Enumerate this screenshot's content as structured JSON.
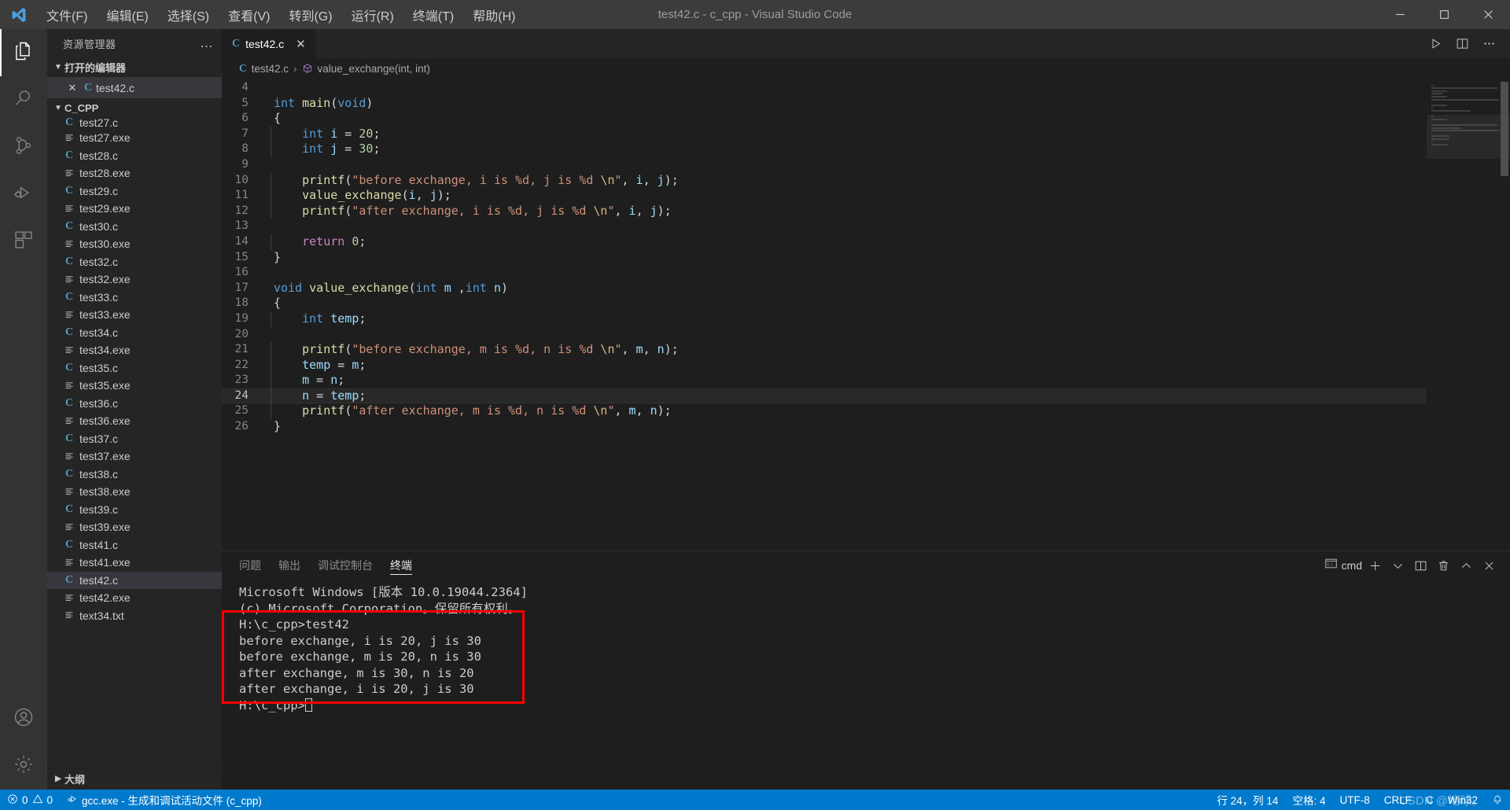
{
  "window": {
    "title": "test42.c - c_cpp - Visual Studio Code",
    "minimize": "─",
    "maximize": "□",
    "close": "✕"
  },
  "menu": [
    {
      "label": "文件(F)"
    },
    {
      "label": "编辑(E)"
    },
    {
      "label": "选择(S)"
    },
    {
      "label": "查看(V)"
    },
    {
      "label": "转到(G)"
    },
    {
      "label": "运行(R)"
    },
    {
      "label": "终端(T)"
    },
    {
      "label": "帮助(H)"
    }
  ],
  "activity_bar": [
    {
      "name": "explorer",
      "icon": "files-icon",
      "active": true
    },
    {
      "name": "search",
      "icon": "search-icon",
      "active": false
    },
    {
      "name": "source-control",
      "icon": "source-control-icon",
      "active": false
    },
    {
      "name": "run-debug",
      "icon": "run-debug-icon",
      "active": false
    },
    {
      "name": "extensions",
      "icon": "extensions-icon",
      "active": false
    },
    {
      "name": "accounts",
      "icon": "account-icon",
      "active": false
    },
    {
      "name": "settings",
      "icon": "gear-icon",
      "active": false
    }
  ],
  "sidebar": {
    "title": "资源管理器",
    "more_actions": "…",
    "open_editors": {
      "label": "打开的编辑器",
      "items": [
        {
          "name": "test42.c",
          "icon": "c-file-icon",
          "selected": true,
          "close": "✕"
        }
      ]
    },
    "folder": {
      "label": "C_CPP",
      "items": [
        {
          "name": "test27.c",
          "icon": "c-file-icon",
          "selected": false,
          "partial": true
        },
        {
          "name": "test27.exe",
          "icon": "exe-file-icon",
          "selected": false
        },
        {
          "name": "test28.c",
          "icon": "c-file-icon",
          "selected": false
        },
        {
          "name": "test28.exe",
          "icon": "exe-file-icon",
          "selected": false
        },
        {
          "name": "test29.c",
          "icon": "c-file-icon",
          "selected": false
        },
        {
          "name": "test29.exe",
          "icon": "exe-file-icon",
          "selected": false
        },
        {
          "name": "test30.c",
          "icon": "c-file-icon",
          "selected": false
        },
        {
          "name": "test30.exe",
          "icon": "exe-file-icon",
          "selected": false
        },
        {
          "name": "test32.c",
          "icon": "c-file-icon",
          "selected": false
        },
        {
          "name": "test32.exe",
          "icon": "exe-file-icon",
          "selected": false
        },
        {
          "name": "test33.c",
          "icon": "c-file-icon",
          "selected": false
        },
        {
          "name": "test33.exe",
          "icon": "exe-file-icon",
          "selected": false
        },
        {
          "name": "test34.c",
          "icon": "c-file-icon",
          "selected": false
        },
        {
          "name": "test34.exe",
          "icon": "exe-file-icon",
          "selected": false
        },
        {
          "name": "test35.c",
          "icon": "c-file-icon",
          "selected": false
        },
        {
          "name": "test35.exe",
          "icon": "exe-file-icon",
          "selected": false
        },
        {
          "name": "test36.c",
          "icon": "c-file-icon",
          "selected": false
        },
        {
          "name": "test36.exe",
          "icon": "exe-file-icon",
          "selected": false
        },
        {
          "name": "test37.c",
          "icon": "c-file-icon",
          "selected": false
        },
        {
          "name": "test37.exe",
          "icon": "exe-file-icon",
          "selected": false
        },
        {
          "name": "test38.c",
          "icon": "c-file-icon",
          "selected": false
        },
        {
          "name": "test38.exe",
          "icon": "exe-file-icon",
          "selected": false
        },
        {
          "name": "test39.c",
          "icon": "c-file-icon",
          "selected": false
        },
        {
          "name": "test39.exe",
          "icon": "exe-file-icon",
          "selected": false
        },
        {
          "name": "test41.c",
          "icon": "c-file-icon",
          "selected": false
        },
        {
          "name": "test41.exe",
          "icon": "exe-file-icon",
          "selected": false
        },
        {
          "name": "test42.c",
          "icon": "c-file-icon",
          "selected": true
        },
        {
          "name": "test42.exe",
          "icon": "exe-file-icon",
          "selected": false
        },
        {
          "name": "text34.txt",
          "icon": "exe-file-icon",
          "selected": false
        }
      ]
    },
    "outline": {
      "label": "大纲"
    }
  },
  "editor": {
    "tab": {
      "name": "test42.c",
      "icon": "c-file-icon",
      "close": "✕"
    },
    "tab_actions": [
      {
        "name": "run-code-button",
        "icon": "play-icon"
      },
      {
        "name": "split-editor-button",
        "icon": "split-icon"
      },
      {
        "name": "more-actions-button",
        "icon": "ellipsis-icon"
      }
    ],
    "breadcrumb": {
      "file": "test42.c",
      "separator": "›",
      "symbol": "value_exchange(int, int)"
    },
    "first_visible_line": 4,
    "current_line": 24,
    "lines": [
      {
        "n": 4,
        "tokens": []
      },
      {
        "n": 5,
        "tokens": [
          {
            "t": "int",
            "c": "kw"
          },
          {
            "t": " ",
            "c": "pun"
          },
          {
            "t": "main",
            "c": "fn"
          },
          {
            "t": "(",
            "c": "pun"
          },
          {
            "t": "void",
            "c": "kw"
          },
          {
            "t": ")",
            "c": "pun"
          }
        ]
      },
      {
        "n": 6,
        "tokens": [
          {
            "t": "{",
            "c": "pun"
          }
        ]
      },
      {
        "n": 7,
        "indent": 1,
        "tokens": [
          {
            "t": "    ",
            "c": "pun"
          },
          {
            "t": "int",
            "c": "kw"
          },
          {
            "t": " ",
            "c": "pun"
          },
          {
            "t": "i",
            "c": "var"
          },
          {
            "t": " = ",
            "c": "pun"
          },
          {
            "t": "20",
            "c": "num"
          },
          {
            "t": ";",
            "c": "pun"
          }
        ]
      },
      {
        "n": 8,
        "indent": 1,
        "tokens": [
          {
            "t": "    ",
            "c": "pun"
          },
          {
            "t": "int",
            "c": "kw"
          },
          {
            "t": " ",
            "c": "pun"
          },
          {
            "t": "j",
            "c": "var"
          },
          {
            "t": " = ",
            "c": "pun"
          },
          {
            "t": "30",
            "c": "num"
          },
          {
            "t": ";",
            "c": "pun"
          }
        ]
      },
      {
        "n": 9,
        "indent": 1,
        "tokens": []
      },
      {
        "n": 10,
        "indent": 1,
        "tokens": [
          {
            "t": "    ",
            "c": "pun"
          },
          {
            "t": "printf",
            "c": "fn"
          },
          {
            "t": "(",
            "c": "pun"
          },
          {
            "t": "\"before exchange, i is %d, j is %d ",
            "c": "str"
          },
          {
            "t": "\\n",
            "c": "esc"
          },
          {
            "t": "\"",
            "c": "str"
          },
          {
            "t": ", ",
            "c": "pun"
          },
          {
            "t": "i",
            "c": "var"
          },
          {
            "t": ", ",
            "c": "pun"
          },
          {
            "t": "j",
            "c": "var"
          },
          {
            "t": ");",
            "c": "pun"
          }
        ]
      },
      {
        "n": 11,
        "indent": 1,
        "tokens": [
          {
            "t": "    ",
            "c": "pun"
          },
          {
            "t": "value_exchange",
            "c": "fn"
          },
          {
            "t": "(",
            "c": "pun"
          },
          {
            "t": "i",
            "c": "var"
          },
          {
            "t": ", ",
            "c": "pun"
          },
          {
            "t": "j",
            "c": "var"
          },
          {
            "t": ");",
            "c": "pun"
          }
        ]
      },
      {
        "n": 12,
        "indent": 1,
        "tokens": [
          {
            "t": "    ",
            "c": "pun"
          },
          {
            "t": "printf",
            "c": "fn"
          },
          {
            "t": "(",
            "c": "pun"
          },
          {
            "t": "\"after exchange, i is %d, j is %d ",
            "c": "str"
          },
          {
            "t": "\\n",
            "c": "esc"
          },
          {
            "t": "\"",
            "c": "str"
          },
          {
            "t": ", ",
            "c": "pun"
          },
          {
            "t": "i",
            "c": "var"
          },
          {
            "t": ", ",
            "c": "pun"
          },
          {
            "t": "j",
            "c": "var"
          },
          {
            "t": ");",
            "c": "pun"
          }
        ]
      },
      {
        "n": 13,
        "indent": 1,
        "tokens": []
      },
      {
        "n": 14,
        "indent": 1,
        "tokens": [
          {
            "t": "    ",
            "c": "pun"
          },
          {
            "t": "return",
            "c": "kw2"
          },
          {
            "t": " ",
            "c": "pun"
          },
          {
            "t": "0",
            "c": "num"
          },
          {
            "t": ";",
            "c": "pun"
          }
        ]
      },
      {
        "n": 15,
        "tokens": [
          {
            "t": "}",
            "c": "pun"
          }
        ]
      },
      {
        "n": 16,
        "tokens": []
      },
      {
        "n": 17,
        "tokens": [
          {
            "t": "void",
            "c": "kw"
          },
          {
            "t": " ",
            "c": "pun"
          },
          {
            "t": "value_exchange",
            "c": "fn"
          },
          {
            "t": "(",
            "c": "pun"
          },
          {
            "t": "int",
            "c": "kw"
          },
          {
            "t": " ",
            "c": "pun"
          },
          {
            "t": "m",
            "c": "var"
          },
          {
            "t": " ,",
            "c": "pun"
          },
          {
            "t": "int",
            "c": "kw"
          },
          {
            "t": " ",
            "c": "pun"
          },
          {
            "t": "n",
            "c": "var"
          },
          {
            "t": ")",
            "c": "pun"
          }
        ]
      },
      {
        "n": 18,
        "tokens": [
          {
            "t": "{",
            "c": "pun"
          }
        ]
      },
      {
        "n": 19,
        "indent": 1,
        "tokens": [
          {
            "t": "    ",
            "c": "pun"
          },
          {
            "t": "int",
            "c": "kw"
          },
          {
            "t": " ",
            "c": "pun"
          },
          {
            "t": "temp",
            "c": "var"
          },
          {
            "t": ";",
            "c": "pun"
          }
        ]
      },
      {
        "n": 20,
        "indent": 1,
        "tokens": []
      },
      {
        "n": 21,
        "indent": 1,
        "tokens": [
          {
            "t": "    ",
            "c": "pun"
          },
          {
            "t": "printf",
            "c": "fn"
          },
          {
            "t": "(",
            "c": "pun"
          },
          {
            "t": "\"before exchange, m is %d, n is %d ",
            "c": "str"
          },
          {
            "t": "\\n",
            "c": "esc"
          },
          {
            "t": "\"",
            "c": "str"
          },
          {
            "t": ", ",
            "c": "pun"
          },
          {
            "t": "m",
            "c": "var"
          },
          {
            "t": ", ",
            "c": "pun"
          },
          {
            "t": "n",
            "c": "var"
          },
          {
            "t": ");",
            "c": "pun"
          }
        ]
      },
      {
        "n": 22,
        "indent": 1,
        "tokens": [
          {
            "t": "    ",
            "c": "pun"
          },
          {
            "t": "temp",
            "c": "var"
          },
          {
            "t": " = ",
            "c": "pun"
          },
          {
            "t": "m",
            "c": "var"
          },
          {
            "t": ";",
            "c": "pun"
          }
        ]
      },
      {
        "n": 23,
        "indent": 1,
        "tokens": [
          {
            "t": "    ",
            "c": "pun"
          },
          {
            "t": "m",
            "c": "var"
          },
          {
            "t": " = ",
            "c": "pun"
          },
          {
            "t": "n",
            "c": "var"
          },
          {
            "t": ";",
            "c": "pun"
          }
        ]
      },
      {
        "n": 24,
        "indent": 1,
        "current": true,
        "tokens": [
          {
            "t": "    ",
            "c": "pun"
          },
          {
            "t": "n",
            "c": "var"
          },
          {
            "t": " = ",
            "c": "pun"
          },
          {
            "t": "temp",
            "c": "var"
          },
          {
            "t": ";",
            "c": "pun"
          }
        ]
      },
      {
        "n": 25,
        "indent": 1,
        "tokens": [
          {
            "t": "    ",
            "c": "pun"
          },
          {
            "t": "printf",
            "c": "fn"
          },
          {
            "t": "(",
            "c": "pun"
          },
          {
            "t": "\"after exchange, m is %d, n is %d ",
            "c": "str"
          },
          {
            "t": "\\n",
            "c": "esc"
          },
          {
            "t": "\"",
            "c": "str"
          },
          {
            "t": ", ",
            "c": "pun"
          },
          {
            "t": "m",
            "c": "var"
          },
          {
            "t": ", ",
            "c": "pun"
          },
          {
            "t": "n",
            "c": "var"
          },
          {
            "t": ");",
            "c": "pun"
          }
        ]
      },
      {
        "n": 26,
        "tokens": [
          {
            "t": "}",
            "c": "pun"
          }
        ]
      }
    ]
  },
  "panel": {
    "tabs": [
      {
        "label": "问题",
        "active": false
      },
      {
        "label": "输出",
        "active": false
      },
      {
        "label": "调试控制台",
        "active": false
      },
      {
        "label": "终端",
        "active": true
      }
    ],
    "actions": {
      "shell_label": "cmd",
      "shell_icon": "terminal-icon",
      "new_terminal": "new-terminal-icon",
      "dropdown": "chevron-down-icon",
      "split": "split-terminal-icon",
      "kill": "trash-icon",
      "maximize": "chevron-up-icon",
      "close": "close-icon"
    },
    "terminal_lines": [
      {
        "text": "Microsoft Windows [版本 10.0.19044.2364]",
        "highlight": false
      },
      {
        "text": "(c) Microsoft Corporation。保留所有权利。",
        "highlight": false
      },
      {
        "text": "",
        "highlight": false
      },
      {
        "text": "H:\\c_cpp>test42",
        "highlight": true
      },
      {
        "text": "before exchange, i is 20, j is 30",
        "highlight": true
      },
      {
        "text": "before exchange, m is 20, n is 30",
        "highlight": true
      },
      {
        "text": "after exchange, m is 30, n is 20",
        "highlight": true
      },
      {
        "text": "after exchange, i is 20, j is 30",
        "highlight": true
      },
      {
        "text": "",
        "highlight": false
      },
      {
        "text": "H:\\c_cpp>",
        "highlight": false,
        "cursor": true
      }
    ],
    "highlight_color": "#ff0000"
  },
  "status_bar": {
    "errors": "0",
    "warnings": "0",
    "task": "gcc.exe - 生成和调试活动文件 (c_cpp)",
    "position": "行 24，列 14",
    "spaces": "空格: 4",
    "encoding": "UTF-8",
    "eol": "CRLF",
    "language": "C",
    "platform": "Win32",
    "watermark": "CSDN @地球。",
    "bell": "bell-icon",
    "accent": "#007acc"
  }
}
